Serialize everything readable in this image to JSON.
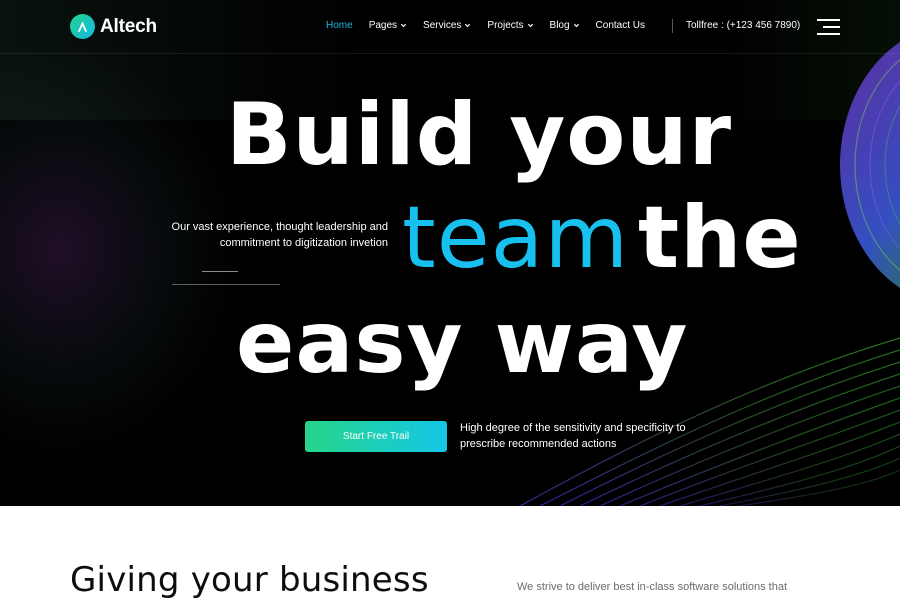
{
  "brand": {
    "name": "Altech"
  },
  "nav": {
    "items": [
      {
        "label": "Home",
        "active": true,
        "dropdown": false
      },
      {
        "label": "Pages",
        "active": false,
        "dropdown": true
      },
      {
        "label": "Services",
        "active": false,
        "dropdown": true
      },
      {
        "label": "Projects",
        "active": false,
        "dropdown": true
      },
      {
        "label": "Blog",
        "active": false,
        "dropdown": true
      },
      {
        "label": "Contact Us",
        "active": false,
        "dropdown": false
      }
    ],
    "tollfree": "Tollfree : (+123 456 7890)"
  },
  "hero": {
    "headline_line1": "Build your",
    "headline_highlight": "team",
    "headline_line2_rest": "the",
    "headline_line3": "easy way",
    "side_text": "Our vast experience, thought leadership and commitment to digitization invetion",
    "cta_label": "Start Free Trail",
    "cta_note": "High degree of the sensitivity and specificity to prescribe recommended actions"
  },
  "about": {
    "title": "Giving your business",
    "text": "We strive to deliver best in-class software solutions that"
  },
  "colors": {
    "accent": "#17c0ef",
    "gradient_start": "#26d58a",
    "gradient_end": "#14c7e7",
    "hero_bg": "#000000"
  },
  "icons": {
    "logo": "logo-a-mark-icon",
    "dropdown": "chevron-down-icon",
    "menu": "hamburger-menu-icon"
  }
}
